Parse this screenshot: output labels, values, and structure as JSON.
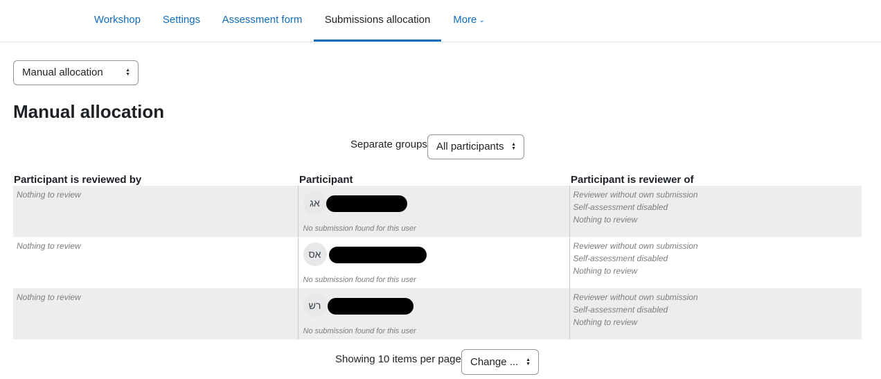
{
  "nav": {
    "tabs": [
      {
        "label": "Workshop"
      },
      {
        "label": "Settings"
      },
      {
        "label": "Assessment form"
      },
      {
        "label": "Submissions allocation"
      },
      {
        "label": "More"
      }
    ],
    "active_tab": "Submissions allocation"
  },
  "allocator_select": {
    "value": "Manual allocation"
  },
  "page_title": "Manual allocation",
  "groups": {
    "label": "Separate groups",
    "value": "All participants"
  },
  "table": {
    "headers": [
      "Participant is reviewed by",
      "Participant",
      "Participant is reviewer of"
    ],
    "rows": [
      {
        "reviewed_by": "Nothing to review",
        "avatar": "אג",
        "submission_status": "No submission found for this user",
        "reviewer_of": [
          "Reviewer without own submission",
          "Self-assessment disabled",
          "Nothing to review"
        ]
      },
      {
        "reviewed_by": "Nothing to review",
        "avatar": "אס",
        "submission_status": "No submission found for this user",
        "reviewer_of": [
          "Reviewer without own submission",
          "Self-assessment disabled",
          "Nothing to review"
        ]
      },
      {
        "reviewed_by": "Nothing to review",
        "avatar": "רש",
        "submission_status": "No submission found for this user",
        "reviewer_of": [
          "Reviewer without own submission",
          "Self-assessment disabled",
          "Nothing to review"
        ]
      }
    ]
  },
  "pagination": {
    "label": "Showing 10 items per page",
    "select_value": "Change ..."
  }
}
